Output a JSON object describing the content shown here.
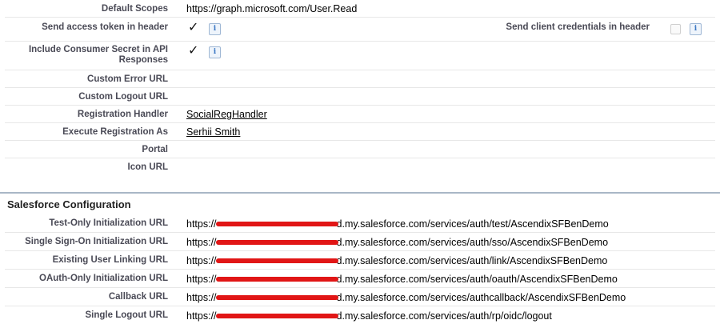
{
  "top_rows": [
    {
      "label": "Default Scopes",
      "value": "https://graph.microsoft.com/User.Read",
      "type": "text"
    },
    {
      "label": "Send access token in header",
      "type": "check"
    },
    {
      "label": "Include Consumer Secret in API Responses",
      "type": "check"
    },
    {
      "label": "Custom Error URL",
      "value": "",
      "type": "text"
    },
    {
      "label": "Custom Logout URL",
      "value": "",
      "type": "text"
    },
    {
      "label": "Registration Handler",
      "value": "SocialRegHandler",
      "type": "link"
    },
    {
      "label": "Execute Registration As",
      "value": "Serhii Smith",
      "type": "link"
    },
    {
      "label": "Portal",
      "value": "",
      "type": "text"
    },
    {
      "label": "Icon URL",
      "value": "",
      "type": "text"
    }
  ],
  "check_mark": "✓",
  "info_glyph": "i",
  "right_option": {
    "label": "Send client credentials in header",
    "checked": false
  },
  "section": {
    "title": "Salesforce Configuration"
  },
  "config_rows": [
    {
      "label": "Test-Only Initialization URL",
      "prefix": "https://",
      "suffix": "d.my.salesforce.com/services/auth/test/AscendixSFBenDemo"
    },
    {
      "label": "Single Sign-On Initialization URL",
      "prefix": "https://",
      "suffix": "d.my.salesforce.com/services/auth/sso/AscendixSFBenDemo"
    },
    {
      "label": "Existing User Linking URL",
      "prefix": "https://",
      "suffix": "d.my.salesforce.com/services/auth/link/AscendixSFBenDemo"
    },
    {
      "label": "OAuth-Only Initialization URL",
      "prefix": "https://",
      "suffix": "d.my.salesforce.com/services/auth/oauth/AscendixSFBenDemo"
    },
    {
      "label": "Callback URL",
      "prefix": "https://",
      "suffix": "d.my.salesforce.com/services/authcallback/AscendixSFBenDemo"
    },
    {
      "label": "Single Logout URL",
      "prefix": "https://",
      "suffix": "d.my.salesforce.com/services/auth/rp/oidc/logout"
    }
  ],
  "colors": {
    "redaction": "#e11616",
    "section_rule": "#a9b7c6",
    "label": "#4a4a56"
  }
}
